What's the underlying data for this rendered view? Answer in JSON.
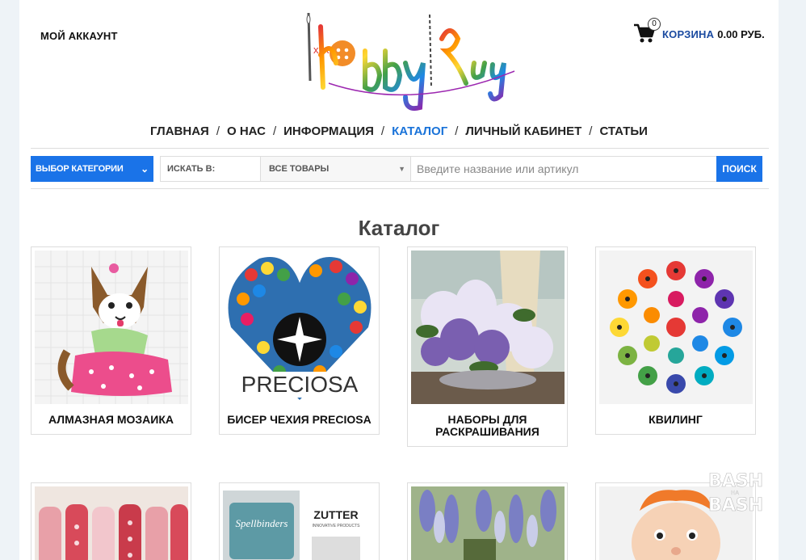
{
  "header": {
    "account_label": "МОЙ АККАУНТ",
    "logo_text": "HobbyRay",
    "cart": {
      "count": "0",
      "label": "КОРЗИНА",
      "total": "0.00 РУБ."
    }
  },
  "nav": {
    "items": [
      {
        "label": "ГЛАВНАЯ"
      },
      {
        "label": "О НАС"
      },
      {
        "label": "ИНФОРМАЦИЯ"
      },
      {
        "label": "КАТАЛОГ"
      },
      {
        "label": "ЛИЧНЫЙ КАБИНЕТ"
      },
      {
        "label": "СТАТЬИ"
      }
    ],
    "separator": "/",
    "active_color": "#1a73d9"
  },
  "search": {
    "category_button": "ВЫБОР КАТЕГОРИИ",
    "search_in_label": "ИСКАТЬ В:",
    "scope_value": "ВСЕ ТОВАРЫ",
    "placeholder": "Введите название или артикул",
    "button_label": "ПОИСК"
  },
  "catalog": {
    "title": "Каталог",
    "items": [
      {
        "label": "АЛМАЗНАЯ МОЗАИКА"
      },
      {
        "label": "БИСЕР ЧЕХИЯ PRECIOSA"
      },
      {
        "label": "НАБОРЫ ДЛЯ РАСКРАШИВАНИЯ"
      },
      {
        "label": "КВИЛИНГ"
      },
      {
        "label": ""
      },
      {
        "label": ""
      },
      {
        "label": ""
      },
      {
        "label": ""
      }
    ],
    "preciosa_logo_text": "PRECIOSA",
    "spellbinders_text": "Spellbinders",
    "zutter_text": "ZUTTER",
    "zutter_sub": "INNOVATIVE PRODUCTS"
  },
  "watermark": {
    "line1": "BASH",
    "small": "НА",
    "line2": "BASH"
  },
  "colors": {
    "accent": "#1a73e8",
    "cart_label": "#1a4aa0"
  }
}
